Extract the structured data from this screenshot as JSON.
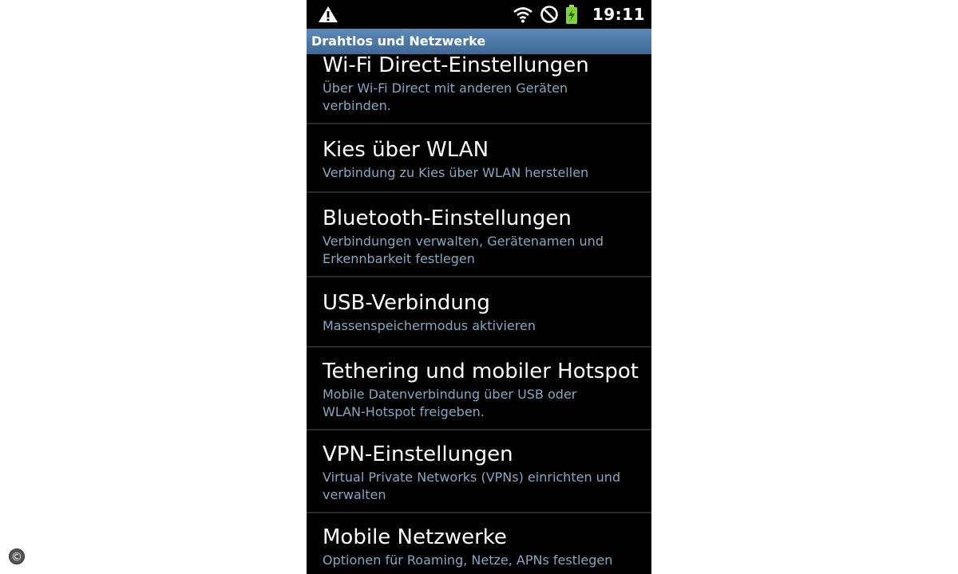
{
  "status_bar": {
    "time": "19:11",
    "icons": [
      "warning-icon",
      "wifi-icon",
      "blocked-icon",
      "battery-icon"
    ],
    "battery_color": "#7fd13b"
  },
  "header": {
    "title": "Drahtlos und Netzwerke",
    "color": "#4f7aa8"
  },
  "settings_items": [
    {
      "title": "Wi-Fi Direct-Einstellungen",
      "summary": "Über Wi-Fi Direct mit anderen Geräten verbinden."
    },
    {
      "title": "Kies über WLAN",
      "summary": "Verbindung zu Kies über WLAN herstellen"
    },
    {
      "title": "Bluetooth-Einstellungen",
      "summary": "Verbindungen verwalten, Gerätenamen und Erkennbarkeit festlegen"
    },
    {
      "title": "USB-Verbindung",
      "summary": "Massenspeichermodus aktivieren"
    },
    {
      "title": "Tethering und mobiler Hotspot",
      "summary": "Mobile Datenverbindung über USB oder WLAN-Hotspot freigeben."
    },
    {
      "title": "VPN-Einstellungen",
      "summary": "Virtual Private Networks (VPNs) einrichten und verwalten"
    },
    {
      "title": "Mobile Netzwerke",
      "summary": "Optionen für Roaming, Netze, APNs festlegen"
    }
  ],
  "watermark": {
    "symbol": "©"
  }
}
